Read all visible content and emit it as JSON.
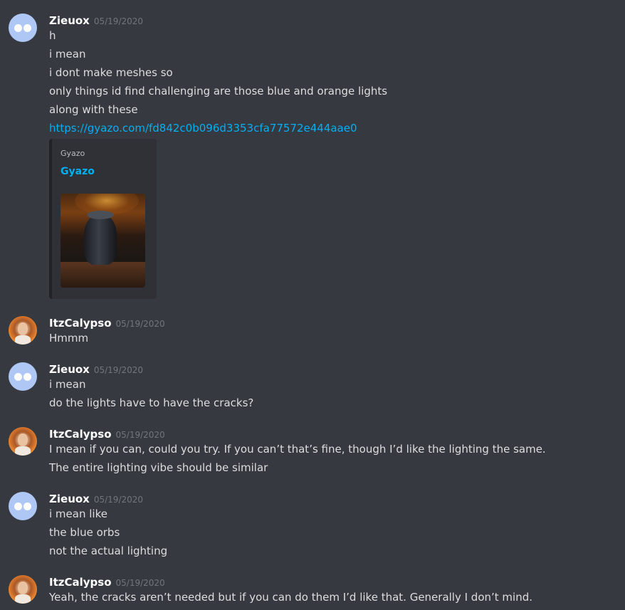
{
  "messages": [
    {
      "username": "Zieuox",
      "timestamp": "05/19/2020",
      "lines": [
        "h",
        "i mean",
        "i dont make meshes so",
        "only things id find challenging are those blue and orange lights",
        "along with these"
      ],
      "link": "https://gyazo.com/fd842c0b096d3353cfa77572e444aae0",
      "embed": {
        "provider": "Gyazo",
        "title": "Gyazo"
      }
    },
    {
      "username": "ItzCalypso",
      "timestamp": "05/19/2020",
      "lines": [
        "Hmmm"
      ]
    },
    {
      "username": "Zieuox",
      "timestamp": "05/19/2020",
      "lines": [
        "i mean",
        "do the lights have to have the cracks?"
      ]
    },
    {
      "username": "ItzCalypso",
      "timestamp": "05/19/2020",
      "lines": [
        "I mean if you can, could you try. If you can’t that’s fine, though I’d like the lighting the same.",
        "The entire lighting vibe should be similar"
      ]
    },
    {
      "username": "Zieuox",
      "timestamp": "05/19/2020",
      "lines": [
        "i mean like",
        "the blue orbs",
        "not the actual lighting"
      ]
    },
    {
      "username": "ItzCalypso",
      "timestamp": "05/19/2020",
      "lines": [
        "Yeah, the cracks aren’t needed but if you can do them I’d like that. Generally I don’t mind."
      ]
    }
  ],
  "colors": {
    "background": "#36393f",
    "username": "#ffffff",
    "message_text": "#dcddde",
    "timestamp": "#72767d",
    "link": "#00b0f4",
    "embed_background": "#2f3136"
  }
}
